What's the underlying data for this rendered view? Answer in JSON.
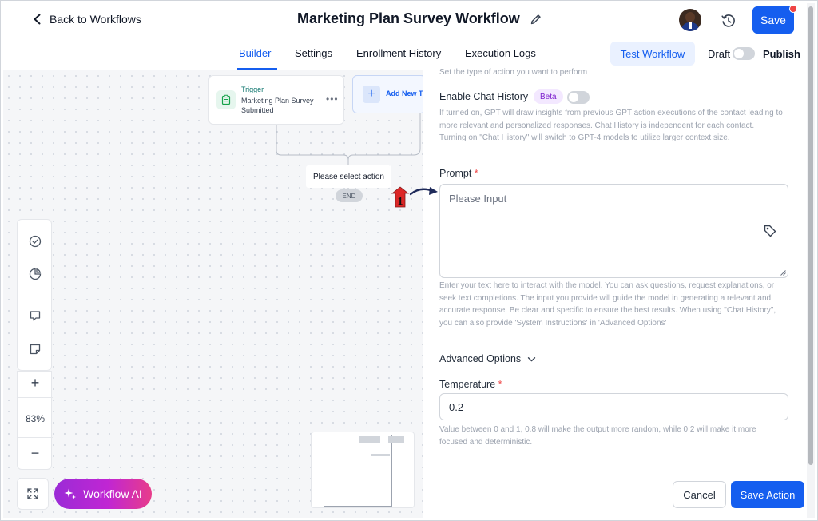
{
  "header": {
    "back_label": "Back to Workflows",
    "workflow_title": "Marketing Plan Survey Workflow",
    "save_label": "Save"
  },
  "tabs": [
    {
      "label": "Builder",
      "active": true
    },
    {
      "label": "Settings",
      "active": false
    },
    {
      "label": "Enrollment History",
      "active": false
    },
    {
      "label": "Execution Logs",
      "active": false
    }
  ],
  "toolbar": {
    "test_workflow_label": "Test Workflow",
    "draft_label": "Draft",
    "publish_label": "Publish"
  },
  "canvas": {
    "trigger": {
      "kicker": "Trigger",
      "name": "Marketing Plan Survey Submitted"
    },
    "add_trigger_label": "Add New Tr",
    "select_action_label": "Please select action",
    "end_label": "END",
    "zoom_level": "83%",
    "workflow_ai_label": "Workflow AI"
  },
  "action_panel": {
    "top_hint": "Set the type of action you want to perform",
    "chat_history": {
      "label": "Enable Chat History",
      "badge": "Beta",
      "help": "If turned on, GPT will draw insights from previous GPT action executions of the contact leading to more relevant and personalized responses. Chat History is independent for each contact. Turning on \"Chat History\" will switch to GPT-4 models to utilize larger context size."
    },
    "prompt": {
      "label": "Prompt",
      "required_mark": "*",
      "placeholder": "Please Input",
      "help": "Enter your text here to interact with the model. You can ask questions, request explanations, or seek text completions. The input you provide will guide the model in generating a relevant and accurate response. Be clear and specific to ensure the best results. When using \"Chat History\", you can also provide 'System Instructions' in 'Advanced Options'"
    },
    "advanced_options_label": "Advanced Options",
    "temperature": {
      "label": "Temperature",
      "required_mark": "*",
      "value": "0.2",
      "help": "Value between 0 and 1, 0.8 will make the output more random, while 0.2 will make it more focused and deterministic."
    },
    "cancel_label": "Cancel",
    "save_action_label": "Save Action"
  },
  "annotation": {
    "marker_number": "1"
  },
  "colors": {
    "primary": "#155eef",
    "ai_gradient_start": "#9b2bd6",
    "ai_gradient_end": "#e83c8a",
    "beta_bg": "#f3e8ff",
    "required": "#ef4444"
  }
}
